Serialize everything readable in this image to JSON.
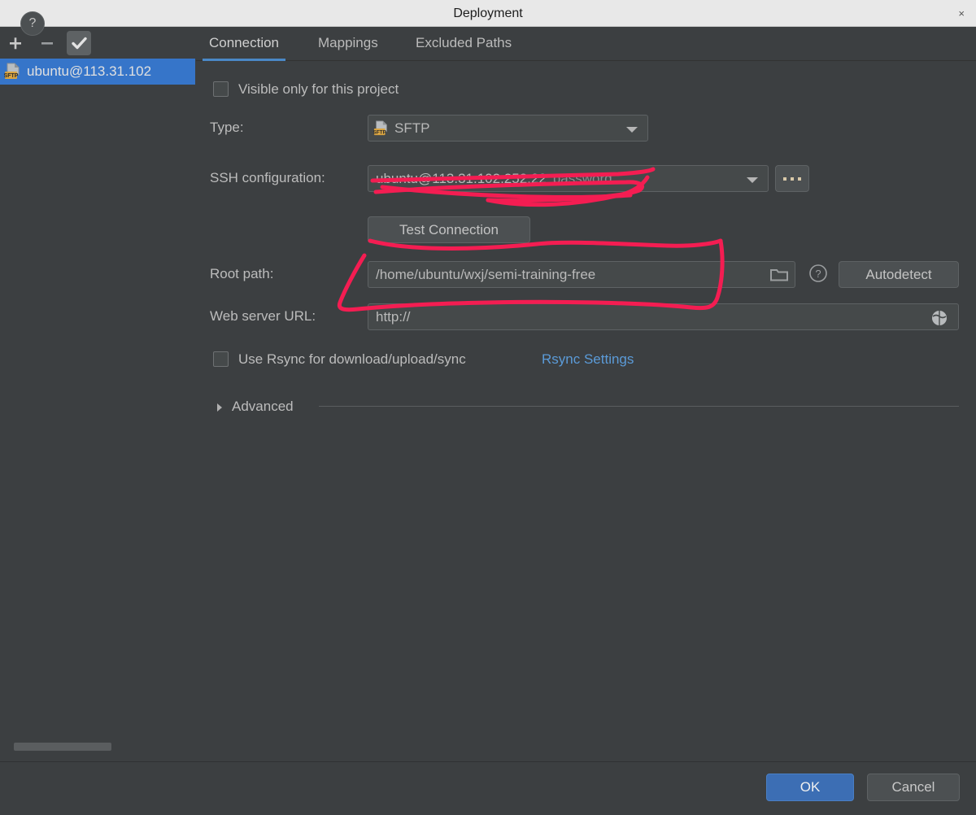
{
  "window": {
    "title": "Deployment",
    "close_label": "×"
  },
  "sidebar": {
    "toolbar": {
      "add_label": "+",
      "remove_label": "−",
      "check_label": "✓"
    },
    "items": [
      {
        "icon": "sftp-server-icon",
        "label": "ubuntu@113.31.102"
      }
    ]
  },
  "tabs": [
    {
      "label": "Connection",
      "active": true
    },
    {
      "label": "Mappings",
      "active": false
    },
    {
      "label": "Excluded Paths",
      "active": false
    }
  ],
  "form": {
    "visible_only_label": "Visible only for this project",
    "visible_only_checked": false,
    "type_label": "Type:",
    "type_value": "SFTP",
    "ssh_config_label": "SSH configuration:",
    "ssh_config_value": "ubuntu@113.31.102.252:22",
    "ssh_config_auth": "password",
    "ssh_browse_label": "...",
    "test_connection_label": "Test Connection",
    "root_path_label": "Root path:",
    "root_path_value": "/home/ubuntu/wxj/semi-training-free",
    "root_path_browse_icon": "folder-icon",
    "root_path_help_icon": "question-mark-icon",
    "autodetect_label": "Autodetect",
    "web_server_url_label": "Web server URL:",
    "web_server_url_value": "http://",
    "web_server_url_icon": "globe-icon",
    "use_rsync_label": "Use Rsync for download/upload/sync",
    "use_rsync_checked": false,
    "rsync_settings_link": "Rsync Settings",
    "advanced_label": "Advanced",
    "advanced_expanded": false
  },
  "footer": {
    "help_label": "?",
    "ok_label": "OK",
    "cancel_label": "Cancel"
  },
  "annotations": {
    "color": "#f41d52",
    "marks": [
      "strikethrough-scribble-over-ssh-configuration",
      "underline-scribble-under-test-connection",
      "circle-scribble-around-root-path"
    ]
  },
  "colors": {
    "window_bg": "#3c3f41",
    "titlebar_bg": "#e8e8e8",
    "selection_blue": "#3675c9",
    "tab_accent": "#4a88c7",
    "link_blue": "#5b9bd8",
    "annotation_red": "#f41d52"
  }
}
